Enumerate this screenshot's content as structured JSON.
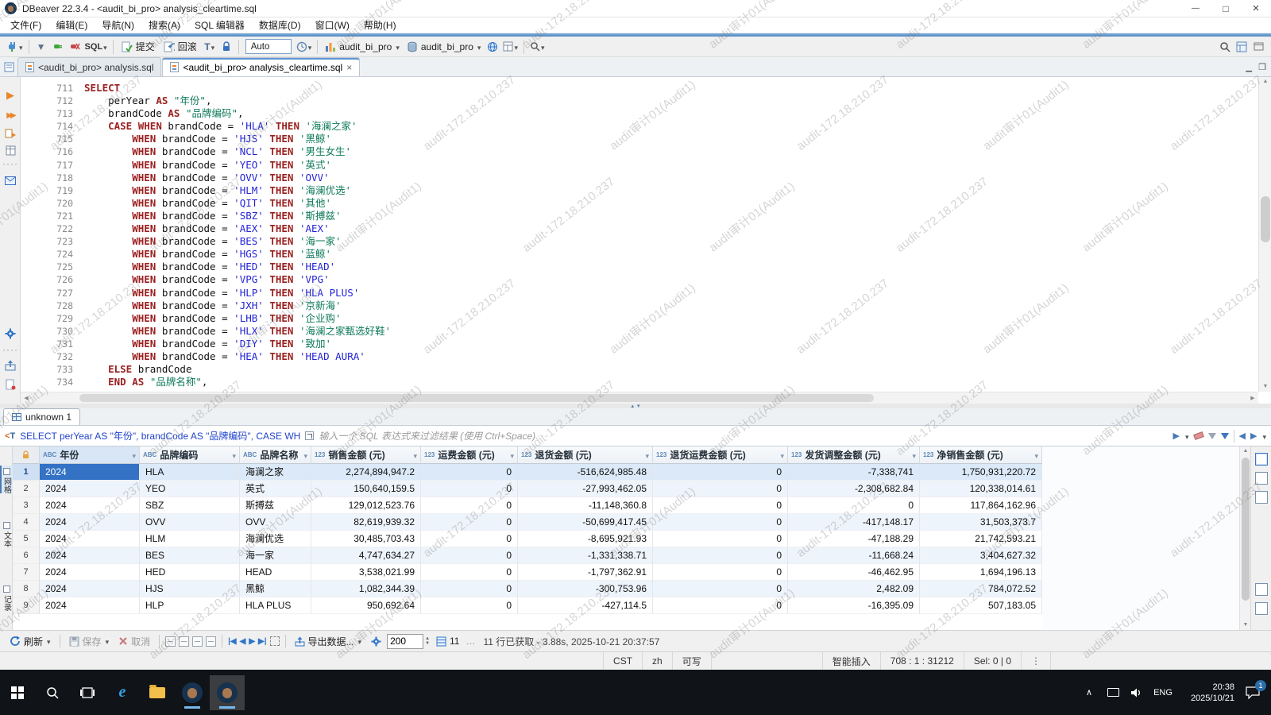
{
  "window": {
    "title": "DBeaver 22.3.4 - <audit_bi_pro> analysis_cleartime.sql"
  },
  "menu": {
    "items": [
      "文件(F)",
      "编辑(E)",
      "导航(N)",
      "搜索(A)",
      "SQL 编辑器",
      "数据库(D)",
      "窗口(W)",
      "帮助(H)"
    ]
  },
  "toolbar": {
    "sql_label": "SQL",
    "commit_label": "提交",
    "rollback_label": "回滚",
    "autocommit_label": "Auto",
    "connection": "audit_bi_pro",
    "schema": "audit_bi_pro"
  },
  "tabs": [
    {
      "label": "<audit_bi_pro> analysis.sql",
      "active": false
    },
    {
      "label": "<audit_bi_pro> analysis_cleartime.sql",
      "active": true
    }
  ],
  "editor": {
    "lines": [
      {
        "num": 711,
        "segs": [
          [
            "kw",
            "SELECT"
          ]
        ]
      },
      {
        "num": 712,
        "segs": [
          [
            "pl",
            "    perYear "
          ],
          [
            "kw",
            "AS"
          ],
          [
            "pl",
            " "
          ],
          [
            "qid",
            "\"年份\""
          ],
          [
            "pl",
            ","
          ]
        ]
      },
      {
        "num": 713,
        "segs": [
          [
            "pl",
            "    brandCode "
          ],
          [
            "kw",
            "AS"
          ],
          [
            "pl",
            " "
          ],
          [
            "qid",
            "\"品牌编码\""
          ],
          [
            "pl",
            ","
          ]
        ]
      },
      {
        "num": 714,
        "segs": [
          [
            "pl",
            "    "
          ],
          [
            "kw",
            "CASE"
          ],
          [
            "pl",
            " "
          ],
          [
            "kw",
            "WHEN"
          ],
          [
            "pl",
            " brandCode = "
          ],
          [
            "str",
            "'HLA'"
          ],
          [
            "pl",
            " "
          ],
          [
            "kw",
            "THEN"
          ],
          [
            "pl",
            " "
          ],
          [
            "zstr",
            "'海澜之家'"
          ]
        ]
      },
      {
        "num": 715,
        "segs": [
          [
            "pl",
            "        "
          ],
          [
            "kw",
            "WHEN"
          ],
          [
            "pl",
            " brandCode = "
          ],
          [
            "str",
            "'HJS'"
          ],
          [
            "pl",
            " "
          ],
          [
            "kw",
            "THEN"
          ],
          [
            "pl",
            " "
          ],
          [
            "zstr",
            "'黑鲸'"
          ]
        ]
      },
      {
        "num": 716,
        "segs": [
          [
            "pl",
            "        "
          ],
          [
            "kw",
            "WHEN"
          ],
          [
            "pl",
            " brandCode = "
          ],
          [
            "str",
            "'NCL'"
          ],
          [
            "pl",
            " "
          ],
          [
            "kw",
            "THEN"
          ],
          [
            "pl",
            " "
          ],
          [
            "zstr",
            "'男生女生'"
          ]
        ]
      },
      {
        "num": 717,
        "segs": [
          [
            "pl",
            "        "
          ],
          [
            "kw",
            "WHEN"
          ],
          [
            "pl",
            " brandCode = "
          ],
          [
            "str",
            "'YEO'"
          ],
          [
            "pl",
            " "
          ],
          [
            "kw",
            "THEN"
          ],
          [
            "pl",
            " "
          ],
          [
            "zstr",
            "'英式'"
          ]
        ]
      },
      {
        "num": 718,
        "segs": [
          [
            "pl",
            "        "
          ],
          [
            "kw",
            "WHEN"
          ],
          [
            "pl",
            " brandCode = "
          ],
          [
            "str",
            "'OVV'"
          ],
          [
            "pl",
            " "
          ],
          [
            "kw",
            "THEN"
          ],
          [
            "pl",
            " "
          ],
          [
            "str",
            "'OVV'"
          ]
        ]
      },
      {
        "num": 719,
        "segs": [
          [
            "pl",
            "        "
          ],
          [
            "kw",
            "WHEN"
          ],
          [
            "pl",
            " brandCode = "
          ],
          [
            "str",
            "'HLM'"
          ],
          [
            "pl",
            " "
          ],
          [
            "kw",
            "THEN"
          ],
          [
            "pl",
            " "
          ],
          [
            "zstr",
            "'海澜优选'"
          ]
        ]
      },
      {
        "num": 720,
        "segs": [
          [
            "pl",
            "        "
          ],
          [
            "kw",
            "WHEN"
          ],
          [
            "pl",
            " brandCode = "
          ],
          [
            "str",
            "'QIT'"
          ],
          [
            "pl",
            " "
          ],
          [
            "kw",
            "THEN"
          ],
          [
            "pl",
            " "
          ],
          [
            "zstr",
            "'其他'"
          ]
        ]
      },
      {
        "num": 721,
        "segs": [
          [
            "pl",
            "        "
          ],
          [
            "kw",
            "WHEN"
          ],
          [
            "pl",
            " brandCode = "
          ],
          [
            "str",
            "'SBZ'"
          ],
          [
            "pl",
            " "
          ],
          [
            "kw",
            "THEN"
          ],
          [
            "pl",
            " "
          ],
          [
            "zstr",
            "'斯搏兹'"
          ]
        ]
      },
      {
        "num": 722,
        "segs": [
          [
            "pl",
            "        "
          ],
          [
            "kw",
            "WHEN"
          ],
          [
            "pl",
            " brandCode = "
          ],
          [
            "str",
            "'AEX'"
          ],
          [
            "pl",
            " "
          ],
          [
            "kw",
            "THEN"
          ],
          [
            "pl",
            " "
          ],
          [
            "str",
            "'AEX'"
          ]
        ]
      },
      {
        "num": 723,
        "segs": [
          [
            "pl",
            "        "
          ],
          [
            "kw",
            "WHEN"
          ],
          [
            "pl",
            " brandCode = "
          ],
          [
            "str",
            "'BES'"
          ],
          [
            "pl",
            " "
          ],
          [
            "kw",
            "THEN"
          ],
          [
            "pl",
            " "
          ],
          [
            "zstr",
            "'海一家'"
          ]
        ]
      },
      {
        "num": 724,
        "segs": [
          [
            "pl",
            "        "
          ],
          [
            "kw",
            "WHEN"
          ],
          [
            "pl",
            " brandCode = "
          ],
          [
            "str",
            "'HGS'"
          ],
          [
            "pl",
            " "
          ],
          [
            "kw",
            "THEN"
          ],
          [
            "pl",
            " "
          ],
          [
            "zstr",
            "'蓝鲸'"
          ]
        ]
      },
      {
        "num": 725,
        "segs": [
          [
            "pl",
            "        "
          ],
          [
            "kw",
            "WHEN"
          ],
          [
            "pl",
            " brandCode = "
          ],
          [
            "str",
            "'HED'"
          ],
          [
            "pl",
            " "
          ],
          [
            "kw",
            "THEN"
          ],
          [
            "pl",
            " "
          ],
          [
            "str",
            "'HEAD'"
          ]
        ]
      },
      {
        "num": 726,
        "segs": [
          [
            "pl",
            "        "
          ],
          [
            "kw",
            "WHEN"
          ],
          [
            "pl",
            " brandCode = "
          ],
          [
            "str",
            "'VPG'"
          ],
          [
            "pl",
            " "
          ],
          [
            "kw",
            "THEN"
          ],
          [
            "pl",
            " "
          ],
          [
            "str",
            "'VPG'"
          ]
        ]
      },
      {
        "num": 727,
        "segs": [
          [
            "pl",
            "        "
          ],
          [
            "kw",
            "WHEN"
          ],
          [
            "pl",
            " brandCode = "
          ],
          [
            "str",
            "'HLP'"
          ],
          [
            "pl",
            " "
          ],
          [
            "kw",
            "THEN"
          ],
          [
            "pl",
            " "
          ],
          [
            "str",
            "'HLA PLUS'"
          ]
        ]
      },
      {
        "num": 728,
        "segs": [
          [
            "pl",
            "        "
          ],
          [
            "kw",
            "WHEN"
          ],
          [
            "pl",
            " brandCode = "
          ],
          [
            "str",
            "'JXH'"
          ],
          [
            "pl",
            " "
          ],
          [
            "kw",
            "THEN"
          ],
          [
            "pl",
            " "
          ],
          [
            "zstr",
            "'京新海'"
          ]
        ]
      },
      {
        "num": 729,
        "segs": [
          [
            "pl",
            "        "
          ],
          [
            "kw",
            "WHEN"
          ],
          [
            "pl",
            " brandCode = "
          ],
          [
            "str",
            "'LHB'"
          ],
          [
            "pl",
            " "
          ],
          [
            "kw",
            "THEN"
          ],
          [
            "pl",
            " "
          ],
          [
            "zstr",
            "'企业购'"
          ]
        ]
      },
      {
        "num": 730,
        "segs": [
          [
            "pl",
            "        "
          ],
          [
            "kw",
            "WHEN"
          ],
          [
            "pl",
            " brandCode = "
          ],
          [
            "str",
            "'HLX'"
          ],
          [
            "pl",
            " "
          ],
          [
            "kw",
            "THEN"
          ],
          [
            "pl",
            " "
          ],
          [
            "zstr",
            "'海澜之家甄选好鞋'"
          ]
        ]
      },
      {
        "num": 731,
        "segs": [
          [
            "pl",
            "        "
          ],
          [
            "kw",
            "WHEN"
          ],
          [
            "pl",
            " brandCode = "
          ],
          [
            "str",
            "'DIY'"
          ],
          [
            "pl",
            " "
          ],
          [
            "kw",
            "THEN"
          ],
          [
            "pl",
            " "
          ],
          [
            "zstr",
            "'致加'"
          ]
        ]
      },
      {
        "num": 732,
        "segs": [
          [
            "pl",
            "        "
          ],
          [
            "kw",
            "WHEN"
          ],
          [
            "pl",
            " brandCode = "
          ],
          [
            "str",
            "'HEA'"
          ],
          [
            "pl",
            " "
          ],
          [
            "kw",
            "THEN"
          ],
          [
            "pl",
            " "
          ],
          [
            "str",
            "'HEAD AURA'"
          ]
        ]
      },
      {
        "num": 733,
        "segs": [
          [
            "pl",
            "    "
          ],
          [
            "kw",
            "ELSE"
          ],
          [
            "pl",
            " brandCode"
          ]
        ]
      },
      {
        "num": 734,
        "segs": [
          [
            "pl",
            "    "
          ],
          [
            "kw",
            "END"
          ],
          [
            "pl",
            " "
          ],
          [
            "kw",
            "AS"
          ],
          [
            "pl",
            " "
          ],
          [
            "qid",
            "\"品牌名称\""
          ],
          [
            "pl",
            ","
          ]
        ]
      }
    ]
  },
  "results": {
    "tab": "unknown 1",
    "filter_sql": "SELECT perYear AS \"年份\", brandCode AS \"品牌编码\", CASE WH",
    "filter_placeholder": "输入一个 SQL 表达式来过滤结果 (使用 Ctrl+Space)",
    "side_tabs": [
      "网格",
      "文本",
      "记录"
    ],
    "columns": [
      {
        "type": "ABC",
        "label": "年份"
      },
      {
        "type": "ABC",
        "label": "品牌编码"
      },
      {
        "type": "ABC",
        "label": "品牌名称"
      },
      {
        "type": "123",
        "label": "销售金额 (元)"
      },
      {
        "type": "123",
        "label": "运费金额 (元)"
      },
      {
        "type": "123",
        "label": "退货金额 (元)"
      },
      {
        "type": "123",
        "label": "退货运费金额 (元)"
      },
      {
        "type": "123",
        "label": "发货调整金额 (元)"
      },
      {
        "type": "123",
        "label": "净销售金额 (元)"
      }
    ],
    "rows": [
      [
        "2024",
        "HLA",
        "海澜之家",
        "2,274,894,947.2",
        "0",
        "-516,624,985.48",
        "0",
        "-7,338,741",
        "1,750,931,220.72"
      ],
      [
        "2024",
        "YEO",
        "英式",
        "150,640,159.5",
        "0",
        "-27,993,462.05",
        "0",
        "-2,308,682.84",
        "120,338,014.61"
      ],
      [
        "2024",
        "SBZ",
        "斯搏兹",
        "129,012,523.76",
        "0",
        "-11,148,360.8",
        "0",
        "0",
        "117,864,162.96"
      ],
      [
        "2024",
        "OVV",
        "OVV",
        "82,619,939.32",
        "0",
        "-50,699,417.45",
        "0",
        "-417,148.17",
        "31,503,373.7"
      ],
      [
        "2024",
        "HLM",
        "海澜优选",
        "30,485,703.43",
        "0",
        "-8,695,921.93",
        "0",
        "-47,188.29",
        "21,742,593.21"
      ],
      [
        "2024",
        "BES",
        "海一家",
        "4,747,634.27",
        "0",
        "-1,331,338.71",
        "0",
        "-11,668.24",
        "3,404,627.32"
      ],
      [
        "2024",
        "HED",
        "HEAD",
        "3,538,021.99",
        "0",
        "-1,797,362.91",
        "0",
        "-46,462.95",
        "1,694,196.13"
      ],
      [
        "2024",
        "HJS",
        "黑鲸",
        "1,082,344.39",
        "0",
        "-300,753.96",
        "0",
        "2,482.09",
        "784,072.52"
      ],
      [
        "2024",
        "HLP",
        "HLA PLUS",
        "950,692.64",
        "0",
        "-427,114.5",
        "0",
        "-16,395.09",
        "507,183.05"
      ]
    ],
    "toolbar": {
      "refresh": "刷新",
      "save": "保存",
      "cancel": "取消",
      "export": "导出数据...",
      "fetch_size": "200",
      "row_count": "11",
      "status": "11 行已获取 - 3.88s, 2025-10-21 20:37:57"
    }
  },
  "statusbar": {
    "tz": "CST",
    "lang": "zh",
    "writable": "可写",
    "insert_mode": "智能插入",
    "position": "708 : 1 : 31212",
    "selection": "Sel: 0 | 0"
  },
  "taskbar": {
    "lang": "ENG",
    "time": "20:38",
    "date": "2025/10/21",
    "badge": "1"
  },
  "watermark": {
    "texts": [
      "audit审计01(Audit1)",
      "audit-172.18.210.237"
    ]
  }
}
